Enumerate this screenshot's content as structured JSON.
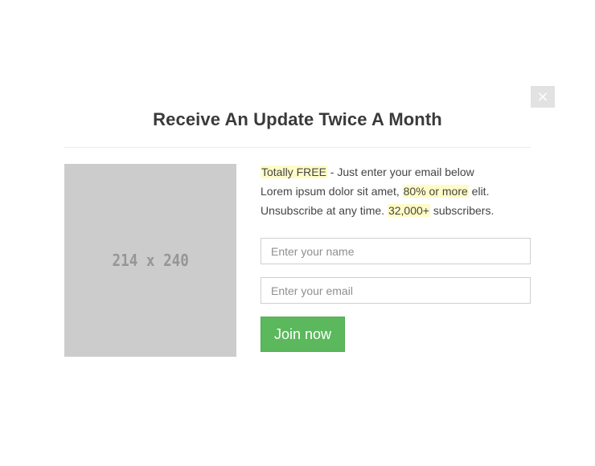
{
  "modal": {
    "close_label": "×",
    "close_icon": "close-icon",
    "title": "Receive An Update Twice A Month",
    "image_placeholder": "214 x 240",
    "copy": {
      "line1_highlight": "Totally FREE",
      "line1_rest": " - Just enter your email below",
      "line2_start": "Lorem ipsum dolor sit amet, ",
      "line2_highlight": "80% or more",
      "line2_end": " elit.",
      "line3_start": "Unsubscribe at any time. ",
      "line3_highlight": "32,000+",
      "line3_end": " subscribers."
    },
    "form": {
      "name_placeholder": "Enter your name",
      "name_value": "",
      "email_placeholder": "Enter your email",
      "email_value": "",
      "submit_label": "Join now"
    },
    "colors": {
      "highlight": "#fffbc7",
      "button": "#5cb85c",
      "placeholder_bg": "#cccccc",
      "close_bg": "#e2e2e2"
    }
  }
}
